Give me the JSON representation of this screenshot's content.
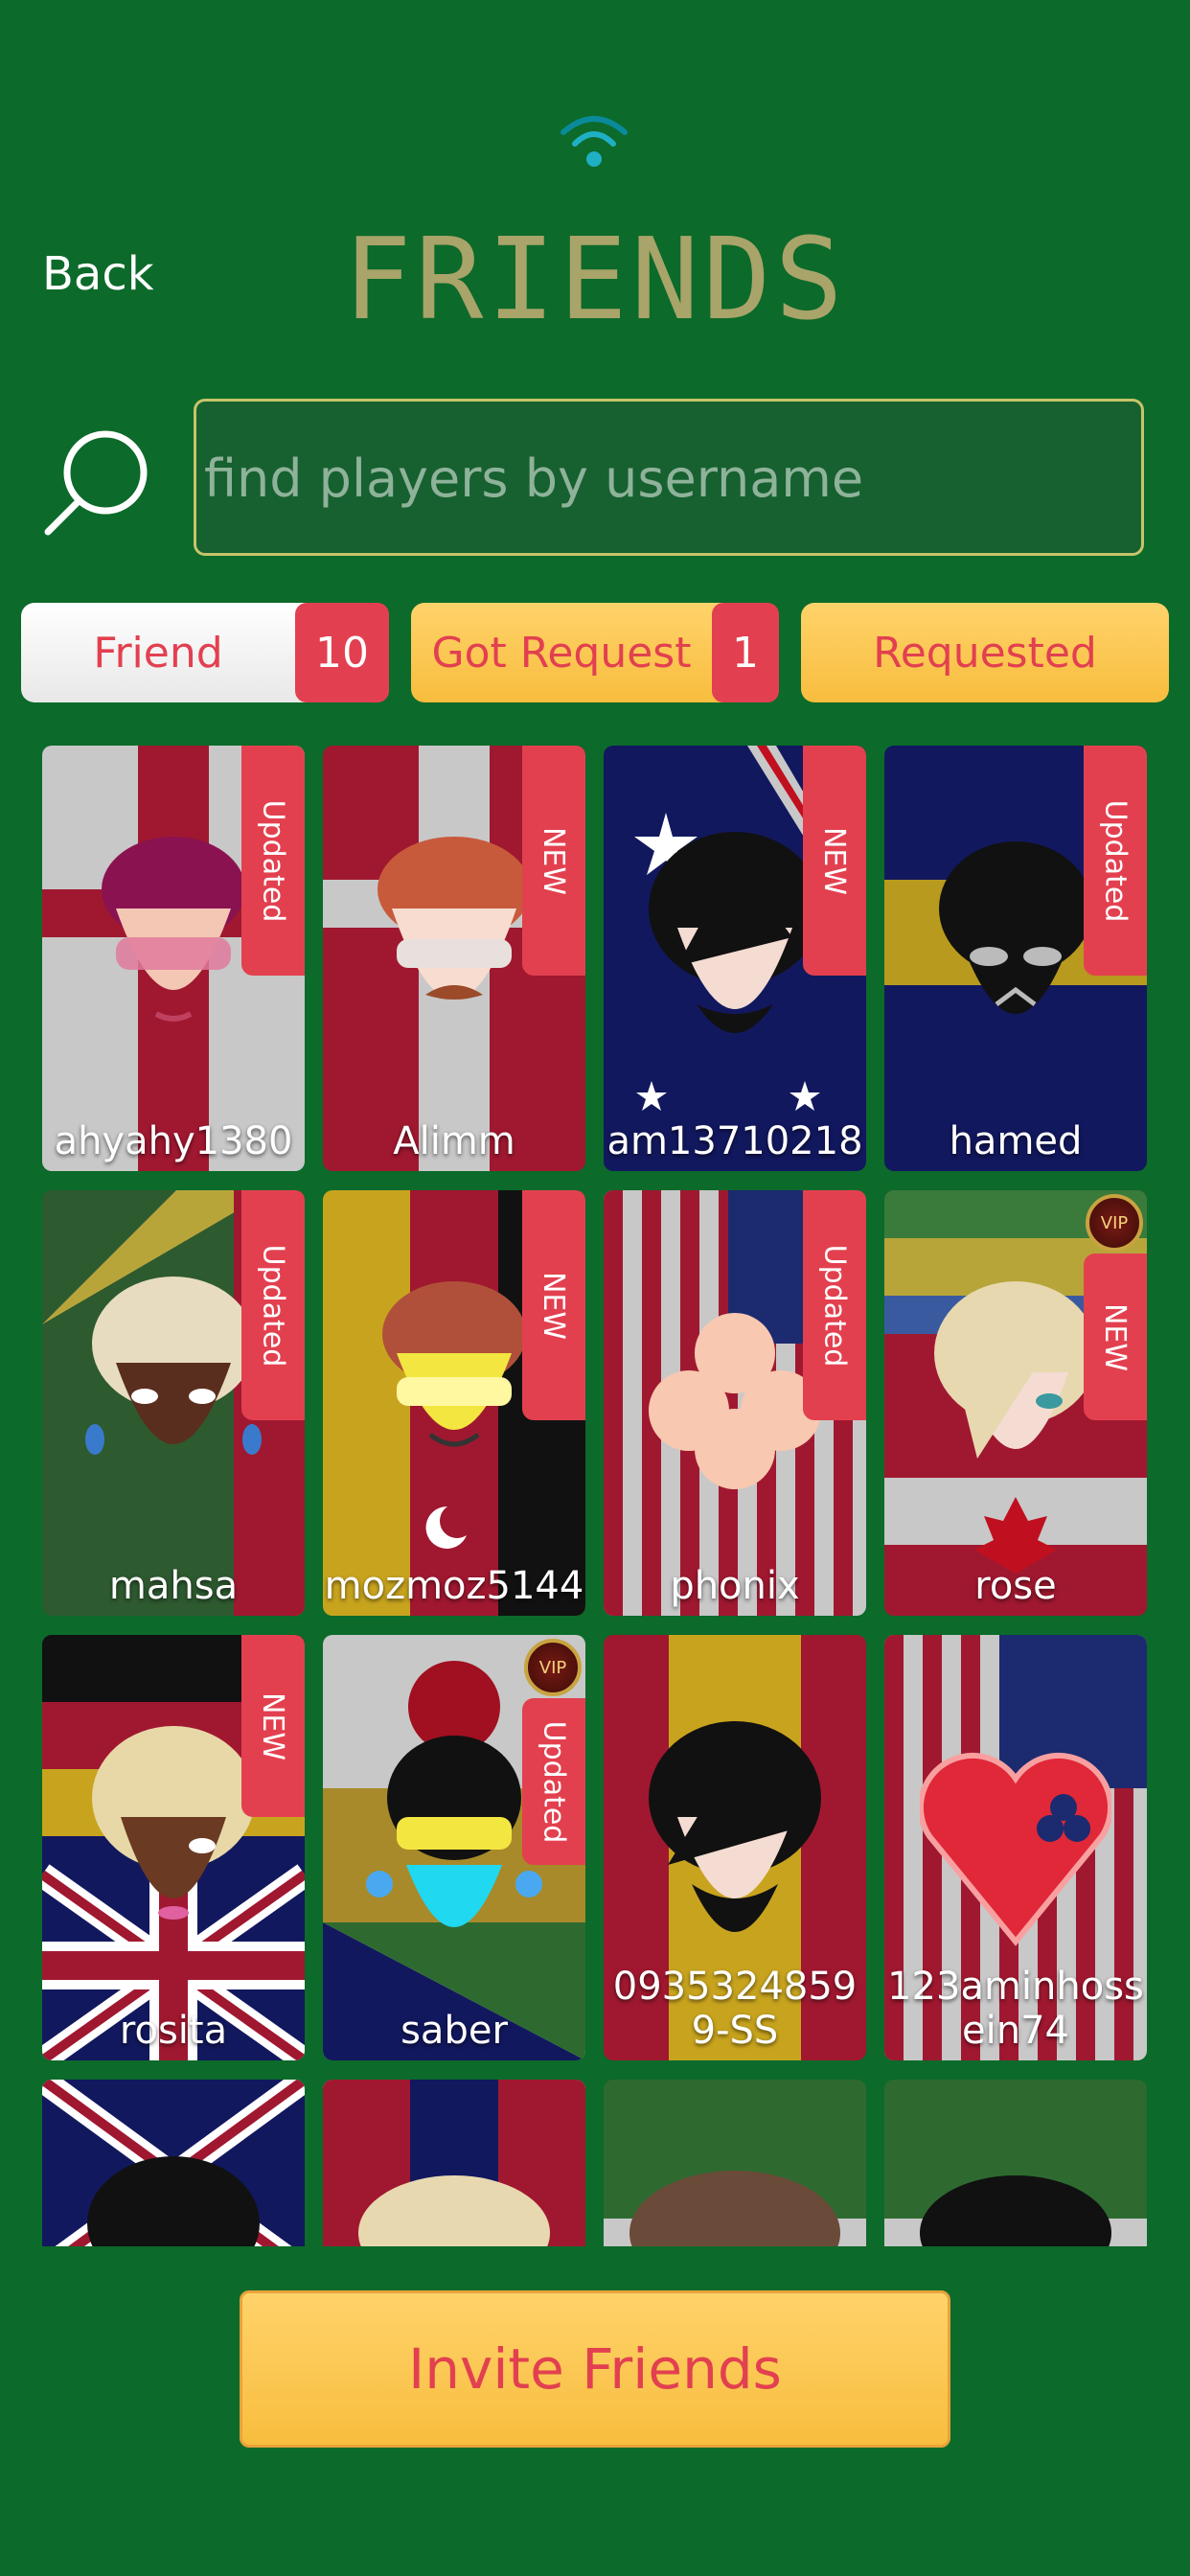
{
  "header": {
    "back_label": "Back",
    "title": "FRIENDS"
  },
  "search": {
    "placeholder": "find players by username",
    "value": ""
  },
  "tabs": [
    {
      "label": "Friend",
      "count": "10"
    },
    {
      "label": "Got Request",
      "count": "1"
    },
    {
      "label": "Requested"
    }
  ],
  "friends": [
    {
      "username": "ahyahy1380",
      "badge": "Updated",
      "vip": false
    },
    {
      "username": "Alimm",
      "badge": "NEW",
      "vip": false
    },
    {
      "username": "am13710218",
      "badge": "NEW",
      "vip": false
    },
    {
      "username": "hamed",
      "badge": "Updated",
      "vip": false
    },
    {
      "username": "mahsa",
      "badge": "Updated",
      "vip": false
    },
    {
      "username": "mozmoz5144",
      "badge": "NEW",
      "vip": false
    },
    {
      "username": "phonix",
      "badge": "Updated",
      "vip": false
    },
    {
      "username": "rose",
      "badge": "NEW",
      "vip": true,
      "vip_text": "VIP"
    },
    {
      "username": "rosita",
      "badge": "NEW",
      "vip": false
    },
    {
      "username": "saber",
      "badge": "Updated",
      "vip": true,
      "vip_text": "VIP"
    },
    {
      "username": "0935324859\n9-SS",
      "badge": "",
      "vip": false
    },
    {
      "username": "123aminhoss\nein74",
      "badge": "",
      "vip": false
    }
  ],
  "invite": {
    "label": "Invite Friends"
  },
  "colors": {
    "background": "#0c6a2a",
    "accent_red": "#e24050",
    "accent_yellow": "#f8bd3e",
    "title": "#a9a46a"
  }
}
